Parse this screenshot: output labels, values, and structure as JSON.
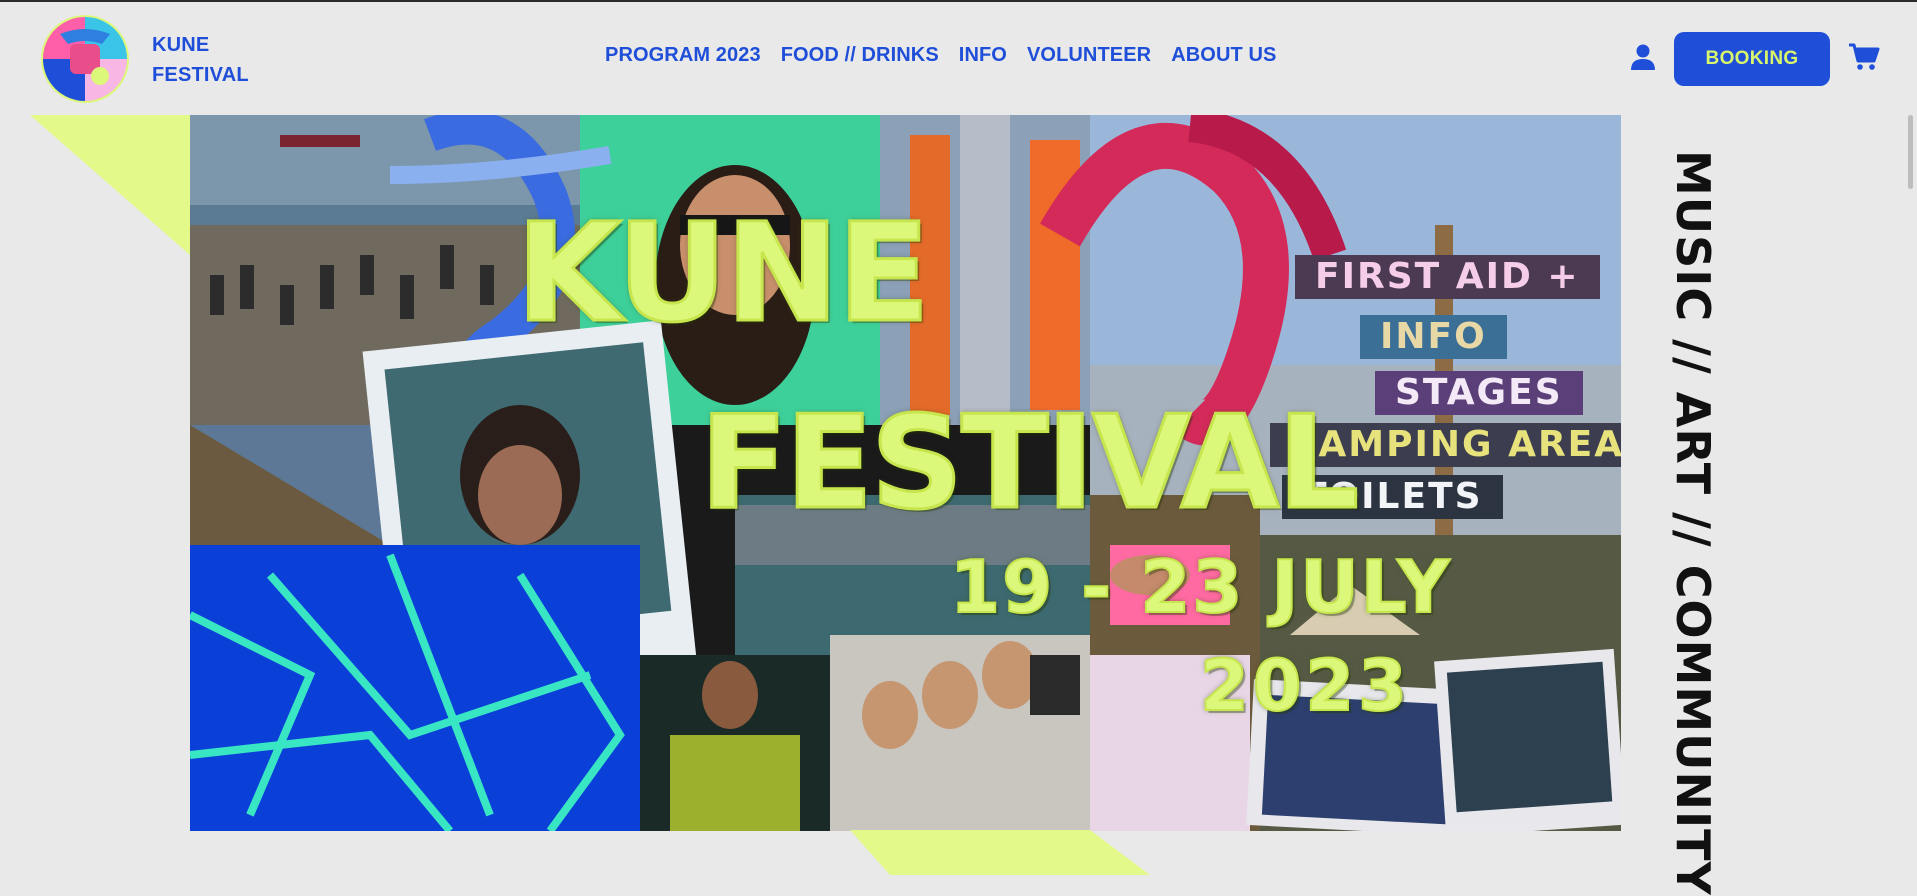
{
  "brand": {
    "line1": "KUNE",
    "line2": "FESTIVAL"
  },
  "nav": {
    "items": [
      "PROGRAM 2023",
      "FOOD // DRINKS",
      "INFO",
      "VOLUNTEER",
      "ABOUT US"
    ]
  },
  "header": {
    "user_icon": "user-icon",
    "booking_label": "BOOKING",
    "cart_icon": "shopping-cart-icon"
  },
  "hero": {
    "title_line1": "KUNE",
    "title_line2": "FESTIVAL",
    "dates": "19 - 23 JULY",
    "year": "2023",
    "signs": [
      "FIRST AID +",
      "INFO",
      "STAGES",
      "CAMPING AREA",
      "TOILETS"
    ]
  },
  "tagline": "MUSIC // ART // COMMUNITY",
  "colors": {
    "accent_blue": "#1f4fd8",
    "accent_lime": "#dcf87a",
    "background": "#e9e9e9"
  }
}
